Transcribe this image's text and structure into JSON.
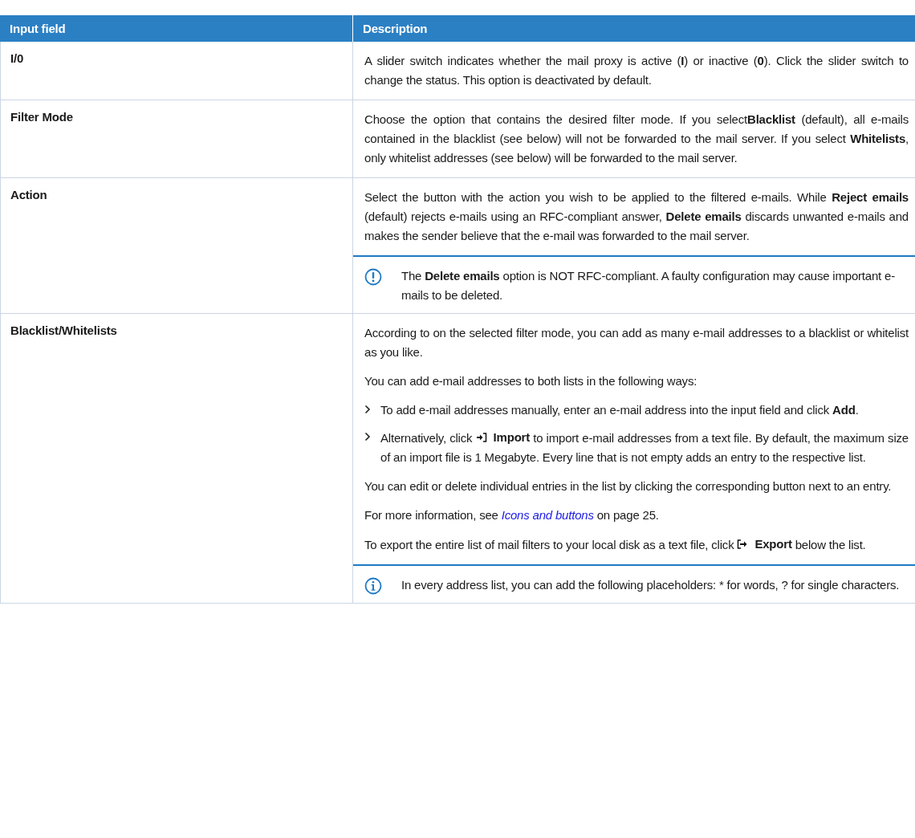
{
  "table": {
    "columns": [
      "Input field",
      "Description"
    ],
    "rows": [
      {
        "field": "I/0",
        "blocks": [
          {
            "kind": "para",
            "segments": [
              {
                "kind": "text",
                "text": "A slider switch indicates whether the mail proxy is active (**I**) or inactive (**0**). Click the slider switch to change the status. This option is deactivated by default."
              }
            ]
          }
        ]
      },
      {
        "field": "Filter Mode",
        "blocks": [
          {
            "kind": "para",
            "segments": [
              {
                "kind": "text",
                "text": "Choose the option that contains the desired filter mode. If you select**Blacklist** (default), all e-mails contained in the blacklist (see below) will not be forwarded to the mail server. If you select **Whitelists**, only whitelist addresses (see below) will be forwarded to the mail server."
              }
            ]
          }
        ]
      },
      {
        "field": "Action",
        "blocks": [
          {
            "kind": "para",
            "segments": [
              {
                "kind": "text",
                "text": "Select the button with the action you wish to be applied to the filtered e-mails. While **Reject emails** (default) rejects e-mails using an RFC-compliant answer, **Delete emails** discards unwanted e-mails and makes the sender believe that the e-mail was forwarded to the mail server."
              }
            ]
          },
          {
            "kind": "warning",
            "text": "The **Delete emails** option is NOT RFC-compliant. A faulty configuration may cause important e-mails to be deleted."
          }
        ]
      },
      {
        "field": "Blacklist/Whitelists",
        "blocks": [
          {
            "kind": "para",
            "segments": [
              {
                "kind": "text",
                "text": "According to on the selected filter mode, you can add as many e-mail addresses to a blacklist or whitelist as you like."
              }
            ]
          },
          {
            "kind": "para",
            "segments": [
              {
                "kind": "text",
                "text": "You can add e-mail addresses to both lists in the following ways:"
              }
            ]
          },
          {
            "kind": "bullet",
            "segments": [
              {
                "kind": "text",
                "text": "To add e-mail addresses manually, enter an e-mail address into the input field and click **Add**."
              }
            ]
          },
          {
            "kind": "bullet",
            "segments": [
              {
                "kind": "text",
                "text": "Alternatively, click"
              },
              {
                "kind": "import",
                "text": "Import"
              },
              {
                "kind": "text",
                "text": "to import e-mail addresses from a text file. By default, the maximum size of an import file is 1 Megabyte. Every line that is not empty adds an entry to the respective list."
              }
            ]
          },
          {
            "kind": "para",
            "segments": [
              {
                "kind": "text",
                "text": "You can edit or delete individual entries in the list by clicking the corresponding button next to an entry."
              }
            ]
          },
          {
            "kind": "para",
            "segments": [
              {
                "kind": "text",
                "text": "For more information, see"
              },
              {
                "kind": "link",
                "text": "Icons and buttons"
              },
              {
                "kind": "text",
                "text": "on page 25."
              }
            ]
          },
          {
            "kind": "para",
            "segments": [
              {
                "kind": "text",
                "text": "To export the entire list of mail filters to your local disk as a text file, click"
              },
              {
                "kind": "export",
                "text": "Export"
              },
              {
                "kind": "text",
                "text": "below the list."
              }
            ]
          },
          {
            "kind": "info",
            "text": "In every address list, you can add the following placeholders: * for words, ? for single characters."
          }
        ]
      }
    ]
  }
}
